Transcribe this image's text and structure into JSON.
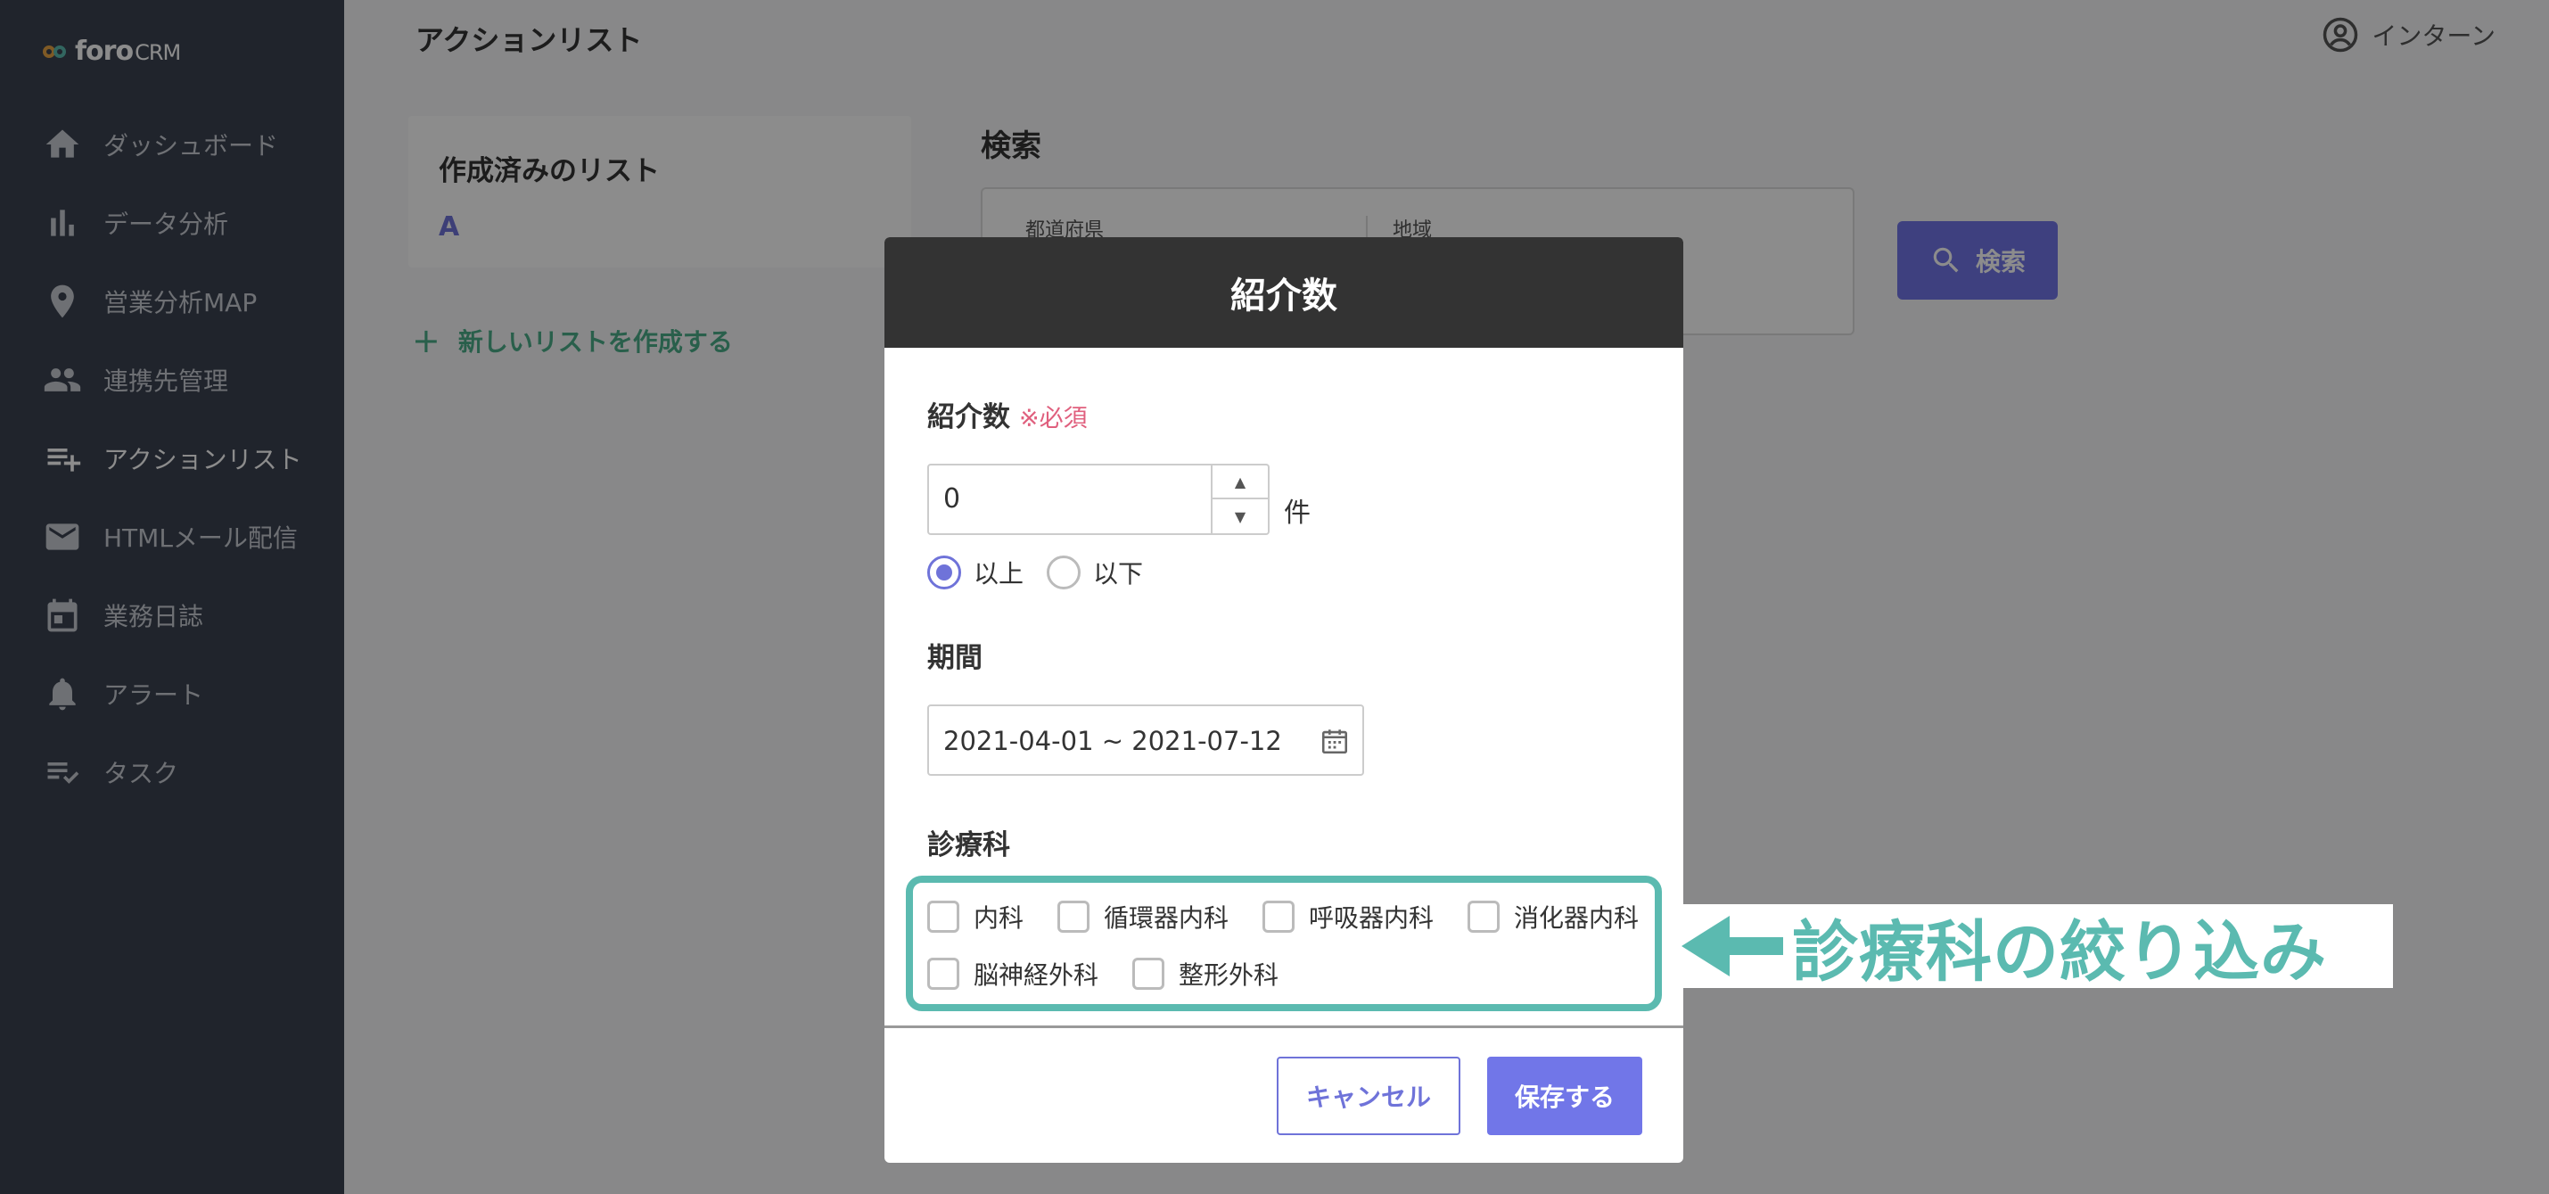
{
  "app": {
    "brand": "foro",
    "brand_suffix": "CRM"
  },
  "sidebar": {
    "items": [
      {
        "label": "ダッシュボード",
        "icon": "home-icon"
      },
      {
        "label": "データ分析",
        "icon": "bar-chart-icon"
      },
      {
        "label": "営業分析MAP",
        "icon": "map-pin-icon"
      },
      {
        "label": "連携先管理",
        "icon": "people-icon"
      },
      {
        "label": "アクションリスト",
        "icon": "playlist-add-icon"
      },
      {
        "label": "HTMLメール配信",
        "icon": "mail-icon"
      },
      {
        "label": "業務日誌",
        "icon": "calendar-icon"
      },
      {
        "label": "アラート",
        "icon": "bell-icon"
      },
      {
        "label": "タスク",
        "icon": "checklist-icon"
      }
    ]
  },
  "header": {
    "title": "アクションリスト",
    "user_name": "インターン"
  },
  "lists": {
    "title": "作成済みのリスト",
    "items": [
      "A"
    ],
    "new_label": "新しいリストを作成する"
  },
  "search": {
    "title": "検索",
    "prefecture_label": "都道府県",
    "region_label": "地域",
    "button_label": "検索"
  },
  "modal": {
    "title": "紹介数",
    "count_label": "紹介数",
    "required_label": "※必須",
    "count_value": "0",
    "count_unit": "件",
    "radios": [
      {
        "label": "以上",
        "checked": true
      },
      {
        "label": "以下",
        "checked": false
      }
    ],
    "period_label": "期間",
    "period_value": "2021-04-01 ~ 2021-07-12",
    "dept_label": "診療科",
    "departments": [
      "内科",
      "循環器内科",
      "呼吸器内科",
      "消化器内科",
      "脳神経外科",
      "整形外科"
    ],
    "cancel_label": "キャンセル",
    "save_label": "保存する"
  },
  "annotation": {
    "text": "診療科の絞り込み"
  },
  "colors": {
    "sidebar": "#3b4250",
    "accent": "#7176e8",
    "green": "#4cae89",
    "highlight": "#5bbab0",
    "required": "#e0607e"
  }
}
